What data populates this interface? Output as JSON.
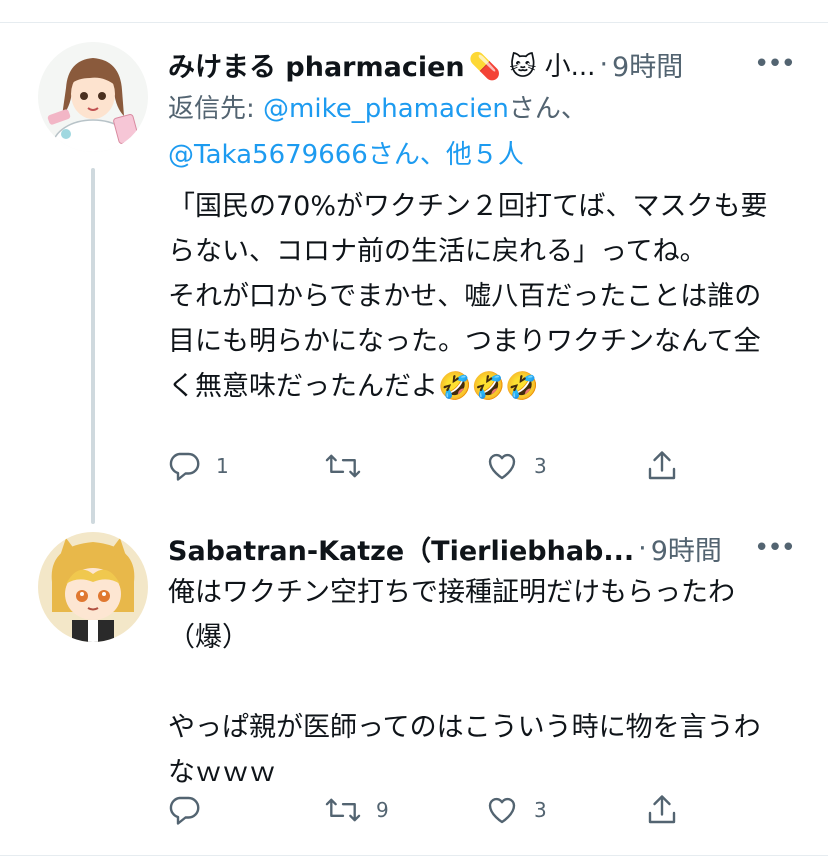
{
  "tweet1": {
    "display_name": "みけまる pharmacien",
    "name_suffix": "💊 🐱 小...",
    "separator": "·",
    "time": "9時間",
    "more": "•••",
    "reply_prefix": "返信先: ",
    "reply_mention_1": "@mike_phamacien",
    "reply_mid": "さん、",
    "reply_mention_2": "@Taka5679666",
    "reply_suffix": "さん、他５人",
    "text": "「国民の70%がワクチン２回打てば、マスクも要らない、コロナ前の生活に戻れる」ってね。\nそれが口からでまかせ、嘘八百だったことは誰の目にも明らかになった。つまりワクチンなんて全く無意味だったんだよ🤣🤣🤣",
    "reply_count": "1",
    "retweet_count": "",
    "like_count": "3"
  },
  "tweet2": {
    "display_name": "Sabatran-Katze（Tierliebhab...",
    "separator": "·",
    "time": "9時間",
    "more": "•••",
    "text": "俺はワクチン空打ちで接種証明だけもらったわ（爆）\n\nやっぱ親が医師ってのはこういう時に物を言うわなｗｗｗ",
    "reply_count": "",
    "retweet_count": "9",
    "like_count": "3"
  },
  "colors": {
    "text_primary": "#0f1419",
    "text_secondary": "#536471",
    "link": "#1d9bf0",
    "thread_line": "#cfd9de"
  },
  "icons": [
    "reply-icon",
    "retweet-icon",
    "like-icon",
    "share-icon",
    "more-icon"
  ]
}
